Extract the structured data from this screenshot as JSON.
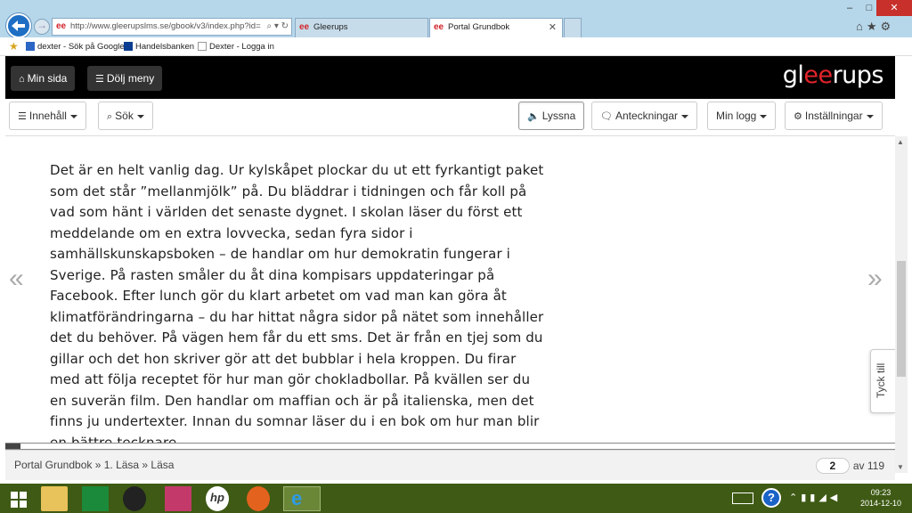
{
  "browser": {
    "address_url": "http://www.gleerupslms.se/gbook/v3/index.php?id=",
    "address_host": "www.gleerupslms.se",
    "tabs": [
      {
        "label": "Gleerups",
        "active": false
      },
      {
        "label": "Portal Grundbok",
        "active": true
      }
    ],
    "favorites": [
      "dexter - Sök på Google",
      "Handelsbanken",
      "Dexter - Logga in"
    ]
  },
  "app": {
    "logo_pre": "gl",
    "logo_mid": "ee",
    "logo_post": "rups",
    "min_sida": "Min sida",
    "dolj_meny": "Dölj meny"
  },
  "toolbar": {
    "innehall": "Innehåll",
    "sok": "Sök",
    "lyssna": "Lyssna",
    "anteckningar": "Anteckningar",
    "min_logg": "Min logg",
    "installningar": "Inställningar"
  },
  "content": {
    "paragraph": "Det är en helt vanlig dag. Ur kylskåpet plockar du ut ett fyrkantigt paket som det står ”mellanmjölk” på. Du bläddrar i tidningen och får koll på vad som hänt i världen det senaste dygnet. I skolan läser du först ett meddelande om en extra lovvecka, sedan fyra sidor i samhällskunskapsboken – de handlar om hur demokratin fungerar i Sverige. På rasten småler du åt dina kompisars uppdateringar på Facebook. Efter lunch gör du klart arbetet om vad man kan göra åt klimatförändringarna – du har hittat några sidor på nätet som innehåller det du behöver. På vägen hem får du ett sms. Det är från en tjej som du gillar och det hon skriver gör att det bubblar i hela kroppen. Du firar med att följa receptet för hur man gör chokladbollar. På kvällen ser du en suverän film. Den handlar om maffian och är på italienska, men det finns ju undertexter. Innan du somnar läser du i en bok om hur man blir en bättre tecknare.",
    "prev_arrow": "«",
    "next_arrow": "»",
    "feedback": "Tyck till",
    "progress_fraction": 0.017
  },
  "footer": {
    "breadcrumb": "Portal Grundbok » 1. Läsa » Läsa",
    "current_page": "2",
    "total_label": "av 119"
  },
  "taskbar": {
    "time": "09:23",
    "date": "2014-12-10"
  }
}
